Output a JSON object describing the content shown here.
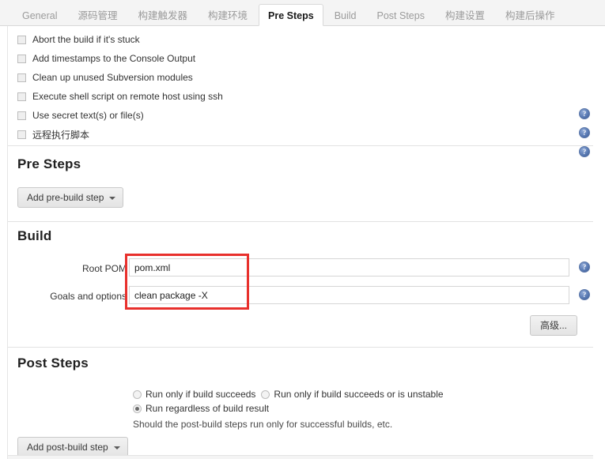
{
  "tabs": [
    {
      "label": "General",
      "active": false
    },
    {
      "label": "源码管理",
      "active": false
    },
    {
      "label": "构建触发器",
      "active": false
    },
    {
      "label": "构建环境",
      "active": false
    },
    {
      "label": "Pre Steps",
      "active": true
    },
    {
      "label": "Build",
      "active": false
    },
    {
      "label": "Post Steps",
      "active": false
    },
    {
      "label": "构建设置",
      "active": false
    },
    {
      "label": "构建后操作",
      "active": false
    }
  ],
  "build_environment": {
    "options": [
      {
        "label": "Abort the build if it's stuck",
        "checked": false,
        "help": false
      },
      {
        "label": "Add timestamps to the Console Output",
        "checked": false,
        "help": false
      },
      {
        "label": "Clean up unused Subversion modules",
        "checked": false,
        "help": false
      },
      {
        "label": "Execute shell script on remote host using ssh",
        "checked": false,
        "help": true
      },
      {
        "label": "Use secret text(s) or file(s)",
        "checked": false,
        "help": true
      },
      {
        "label": "远程执行脚本",
        "checked": false,
        "help": true
      }
    ],
    "help_icon_glyph": "?"
  },
  "pre_steps": {
    "title": "Pre Steps",
    "add_button": "Add pre-build step"
  },
  "build": {
    "title": "Build",
    "rows": [
      {
        "label": "Root POM",
        "value": "pom.xml",
        "placeholder": ""
      },
      {
        "label": "Goals and options",
        "value": "clean package -X",
        "placeholder": ""
      }
    ],
    "advanced_button": "高级...",
    "highlight_color": "#e8302c"
  },
  "post_steps": {
    "title": "Post Steps",
    "radios": [
      {
        "label": "Run only if build succeeds",
        "selected": false
      },
      {
        "label": "Run only if build succeeds or is unstable",
        "selected": false
      },
      {
        "label": "Run regardless of build result",
        "selected": true
      }
    ],
    "hint": "Should the post-build steps run only for successful builds, etc.",
    "add_button": "Add post-build step"
  }
}
